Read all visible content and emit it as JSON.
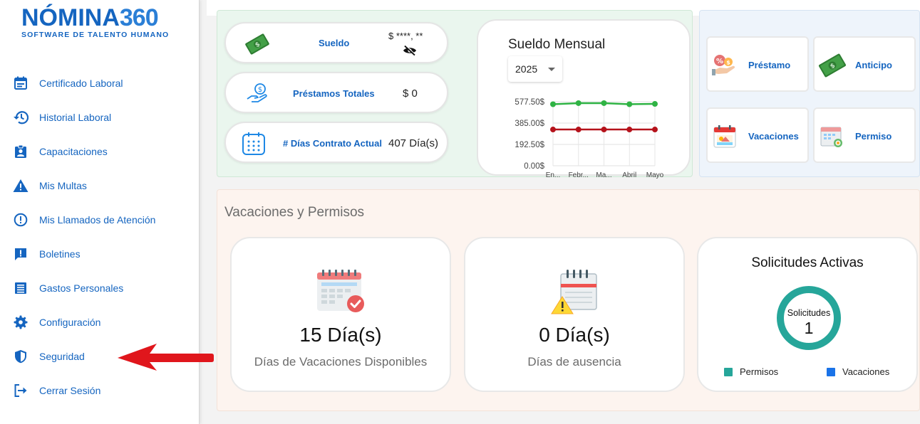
{
  "brand": {
    "name": "NÓMINA",
    "name_number": "360",
    "tagline": "SOFTWARE DE TALENTO HUMANO"
  },
  "sidebar": {
    "items": [
      {
        "label": "Certificado Laboral",
        "icon": "calendar-icon"
      },
      {
        "label": "Historial Laboral",
        "icon": "history-icon"
      },
      {
        "label": "Capacitaciones",
        "icon": "badge-icon"
      },
      {
        "label": "Mis Multas",
        "icon": "warning-icon"
      },
      {
        "label": "Mis Llamados de Atención",
        "icon": "alert-circle-icon"
      },
      {
        "label": "Boletines",
        "icon": "announcement-icon"
      },
      {
        "label": "Gastos Personales",
        "icon": "list-icon"
      },
      {
        "label": "Configuración",
        "icon": "gear-icon"
      },
      {
        "label": "Seguridad",
        "icon": "shield-icon"
      },
      {
        "label": "Cerrar Sesión",
        "icon": "logout-icon"
      }
    ]
  },
  "summary": {
    "salary": {
      "label": "Sueldo",
      "value": "$ ****, **"
    },
    "loans": {
      "label": "Préstamos Totales",
      "value": "$ 0"
    },
    "contract": {
      "label": "# Días Contrato Actual",
      "value": "407 Día(s)"
    }
  },
  "salary_chart": {
    "title": "Sueldo Mensual",
    "year": "2025"
  },
  "chart_data": {
    "type": "line",
    "title": "Sueldo Mensual",
    "categories": [
      "En...",
      "Febr...",
      "Ma...",
      "Abril",
      "Mayo"
    ],
    "y_ticks": [
      "577.50$",
      "385.00$",
      "192.50$",
      "0.00$"
    ],
    "ylim": [
      0,
      577.5
    ],
    "series": [
      {
        "values": [
          555,
          565,
          565,
          555,
          558
        ],
        "color": "#2fb344"
      },
      {
        "values": [
          327,
          327,
          327,
          327,
          327
        ],
        "color": "#b5121b"
      }
    ]
  },
  "requests": {
    "loan": "Préstamo",
    "advance": "Anticipo",
    "vacations": "Vacaciones",
    "permit": "Permiso"
  },
  "vacations": {
    "title": "Vacaciones y Permisos",
    "available": {
      "value": "15 Día(s)",
      "caption": "Días de Vacaciones Disponibles"
    },
    "absence": {
      "value": "0 Día(s)",
      "caption": "Días de ausencia"
    },
    "active": {
      "title": "Solicitudes Activas",
      "center_label": "Solicitudes",
      "center_value": "1",
      "legend": [
        {
          "label": "Permisos",
          "color": "#26a69a"
        },
        {
          "label": "Vacaciones",
          "color": "#1a73e8"
        }
      ]
    }
  }
}
